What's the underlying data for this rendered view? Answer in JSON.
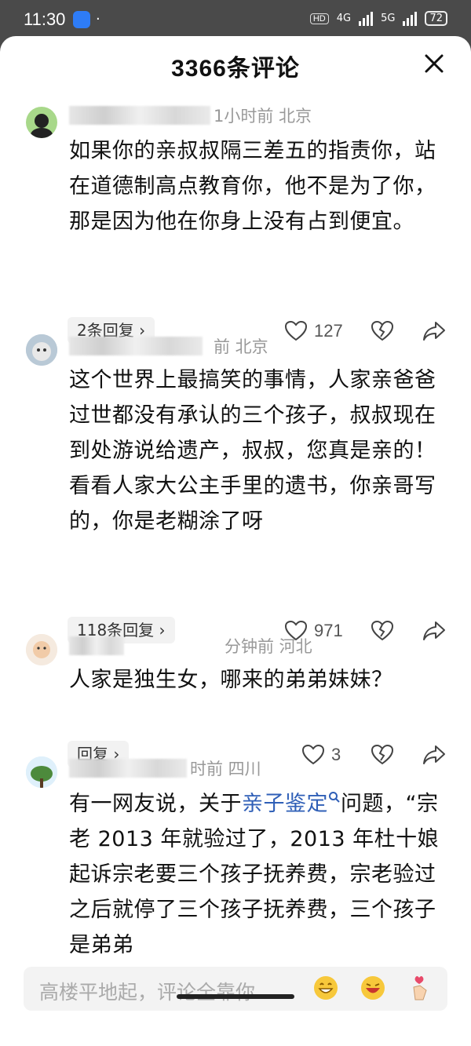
{
  "status_bar": {
    "time": "11:30",
    "extra": "·",
    "hd_tag": "HD",
    "net1": "4G",
    "net2": "5G",
    "battery": "72"
  },
  "header": {
    "title": "3366条评论"
  },
  "comments": [
    {
      "time_loc": "1小时前  北京",
      "text": "如果你的亲叔叔隔三差五的指责你，站在道德制高点教育你，他不是为了你，那是因为他在你身上没有占到便宜。",
      "replies": "2条回复 ›",
      "likes": "127"
    },
    {
      "time_loc": "前  北京",
      "text": "这个世界上最搞笑的事情，人家亲爸爸过世都没有承认的三个孩子，叔叔现在到处游说给遗产，叔叔，您真是亲的！看看人家大公主手里的遗书，你亲哥写的，你是老糊涂了呀",
      "replies": "118条回复 ›",
      "likes": "971"
    },
    {
      "time_loc": "分钟前  河北",
      "text": "人家是独生女，哪来的弟弟妹妹？",
      "replies": "回复 ›",
      "likes": "3"
    },
    {
      "time_loc": "时前  四川",
      "text_before": "有一网友说，关于",
      "link": "亲子鉴定",
      "text_after": "问题，“宗老 2013 年就验过了，2013 年杜十娘起诉宗老要三个孩子抚养费，宗老验过之后就停了三个孩子抚养费，三个孩子是弟弟"
    }
  ],
  "input": {
    "placeholder": "高楼平地起，评论全靠你"
  },
  "icons": [
    "close-icon",
    "heart-icon",
    "broken-heart-icon",
    "share-icon",
    "search-icon",
    "grin-emoji-icon",
    "laugh-emoji-icon",
    "finger-heart-emoji-icon"
  ]
}
